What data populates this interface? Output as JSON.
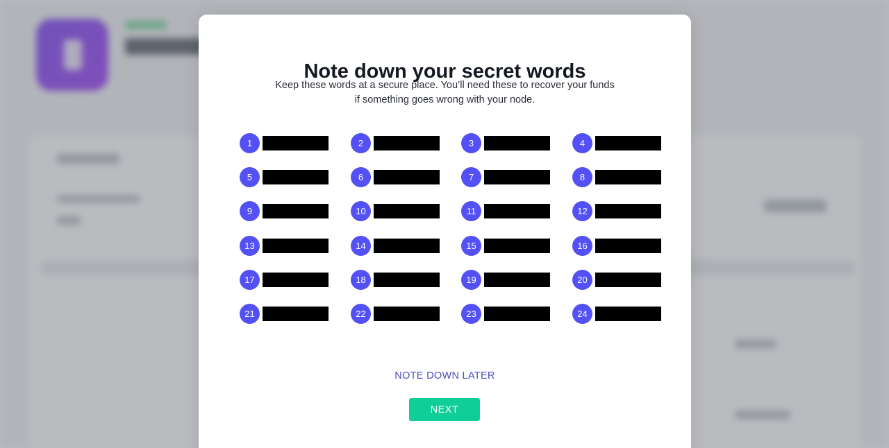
{
  "modal": {
    "title": "Note down your secret words",
    "description": "Keep these words at a secure place. You’ll need these to recover your funds if something goes wrong with your node.",
    "later_label": "NOTE DOWN LATER",
    "next_label": "NEXT"
  },
  "words": [
    {
      "num": "1"
    },
    {
      "num": "2"
    },
    {
      "num": "3"
    },
    {
      "num": "4"
    },
    {
      "num": "5"
    },
    {
      "num": "6"
    },
    {
      "num": "7"
    },
    {
      "num": "8"
    },
    {
      "num": "9"
    },
    {
      "num": "10"
    },
    {
      "num": "11"
    },
    {
      "num": "12"
    },
    {
      "num": "13"
    },
    {
      "num": "14"
    },
    {
      "num": "15"
    },
    {
      "num": "16"
    },
    {
      "num": "17"
    },
    {
      "num": "18"
    },
    {
      "num": "19"
    },
    {
      "num": "20"
    },
    {
      "num": "21"
    },
    {
      "num": "22"
    },
    {
      "num": "23"
    },
    {
      "num": "24"
    }
  ],
  "colors": {
    "number_badge": "#5351f5",
    "next_button": "#0fce97",
    "link": "#4b4cc4"
  }
}
